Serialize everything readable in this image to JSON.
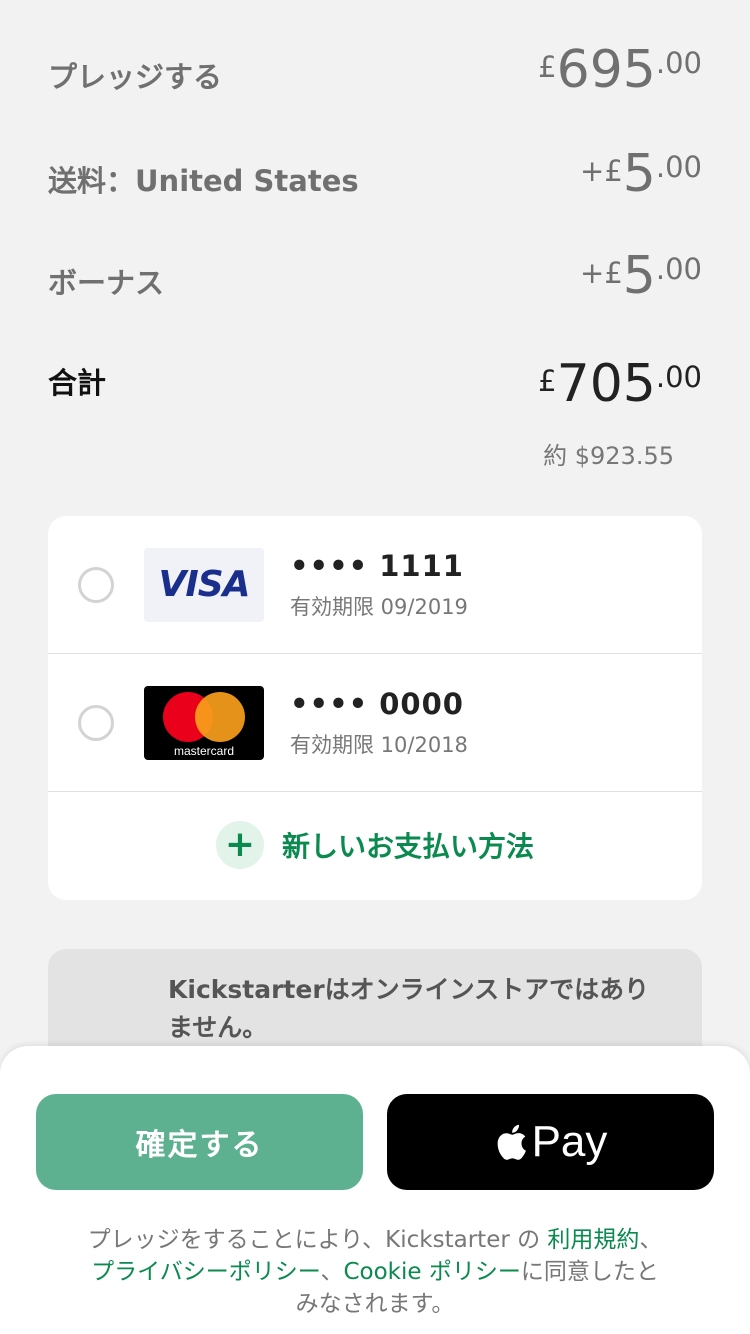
{
  "summary": {
    "pledge": {
      "label": "プレッジする",
      "currency": "£",
      "whole": "695",
      "decimal": ".00"
    },
    "shipping": {
      "label": "送料：United States",
      "currency": "+£",
      "whole": "5",
      "decimal": ".00"
    },
    "bonus": {
      "label": "ボーナス",
      "currency": "+£",
      "whole": "5",
      "decimal": ".00"
    },
    "total": {
      "label": "合計",
      "currency": "£",
      "whole": "705",
      "decimal": ".00"
    },
    "conversion": "約 $923.55"
  },
  "payment_methods": [
    {
      "brand": "VISA",
      "number": "•••• 1111",
      "expiry": "有効期限 09/2019"
    },
    {
      "brand": "mastercard",
      "number": "•••• 0000",
      "expiry": "有効期限 10/2018"
    }
  ],
  "add_payment": {
    "label": "新しいお支払い方法",
    "icon": "+"
  },
  "notice": "Kickstarterはオンラインストアではありません。",
  "buttons": {
    "confirm": "確定する",
    "apple_pay": "Pay"
  },
  "legal": {
    "prefix": "プレッジをすることにより、Kickstarter の ",
    "terms": "利用規約",
    "sep1": "、",
    "privacy": "プライバシーポリシー",
    "sep2": "、",
    "cookie": "Cookie ポリシー",
    "suffix": "に同意したとみなされます。"
  },
  "colors": {
    "accent": "#0b8a4f",
    "confirm": "#5db190"
  }
}
